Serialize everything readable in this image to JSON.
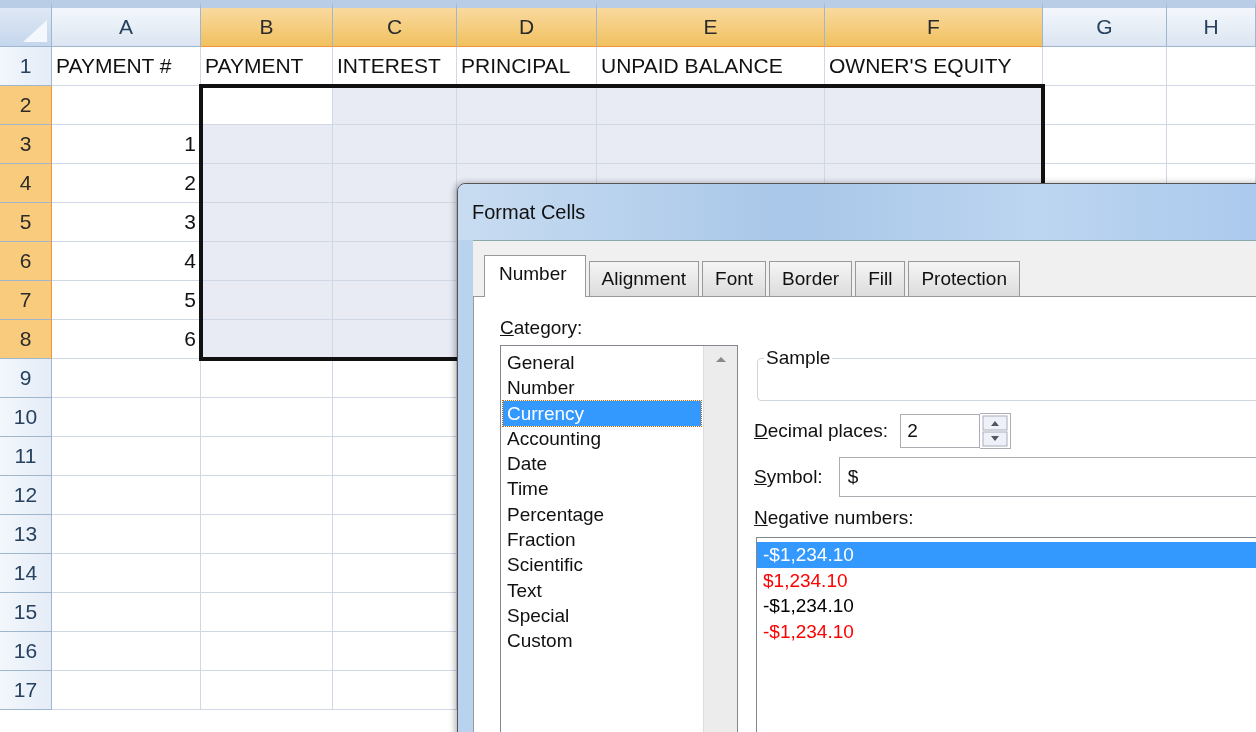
{
  "sheet": {
    "columns": [
      {
        "label": "A",
        "selected": false
      },
      {
        "label": "B",
        "selected": true
      },
      {
        "label": "C",
        "selected": true
      },
      {
        "label": "D",
        "selected": true
      },
      {
        "label": "E",
        "selected": true
      },
      {
        "label": "F",
        "selected": true
      },
      {
        "label": "G",
        "selected": false
      },
      {
        "label": "H",
        "selected": false
      }
    ],
    "rows": [
      {
        "header": "1",
        "selected": false,
        "cells": [
          "PAYMENT #",
          "PAYMENT",
          "INTEREST",
          "PRINCIPAL",
          "UNPAID BALANCE",
          "OWNER'S EQUITY"
        ]
      },
      {
        "header": "2",
        "selected": true,
        "cells": []
      },
      {
        "header": "3",
        "selected": true,
        "cells": [
          "1"
        ]
      },
      {
        "header": "4",
        "selected": true,
        "cells": [
          "2"
        ]
      },
      {
        "header": "5",
        "selected": true,
        "cells": [
          "3"
        ]
      },
      {
        "header": "6",
        "selected": true,
        "cells": [
          "4"
        ]
      },
      {
        "header": "7",
        "selected": true,
        "cells": [
          "5"
        ]
      },
      {
        "header": "8",
        "selected": true,
        "cells": [
          "6"
        ]
      },
      {
        "header": "9",
        "selected": false,
        "cells": []
      },
      {
        "header": "10",
        "selected": false,
        "cells": []
      },
      {
        "header": "11",
        "selected": false,
        "cells": []
      },
      {
        "header": "12",
        "selected": false,
        "cells": []
      },
      {
        "header": "13",
        "selected": false,
        "cells": []
      },
      {
        "header": "14",
        "selected": false,
        "cells": []
      },
      {
        "header": "15",
        "selected": false,
        "cells": []
      },
      {
        "header": "16",
        "selected": false,
        "cells": []
      },
      {
        "header": "17",
        "selected": false,
        "cells": []
      }
    ]
  },
  "dialog": {
    "title": "Format Cells",
    "tabs": [
      {
        "label": "Number",
        "selected": true
      },
      {
        "label": "Alignment",
        "selected": false
      },
      {
        "label": "Font",
        "selected": false
      },
      {
        "label": "Border",
        "selected": false
      },
      {
        "label": "Fill",
        "selected": false
      },
      {
        "label": "Protection",
        "selected": false
      }
    ],
    "category_label": "Category:",
    "categories": [
      {
        "label": "General",
        "selected": false
      },
      {
        "label": "Number",
        "selected": false
      },
      {
        "label": "Currency",
        "selected": true
      },
      {
        "label": "Accounting",
        "selected": false
      },
      {
        "label": "Date",
        "selected": false
      },
      {
        "label": "Time",
        "selected": false
      },
      {
        "label": "Percentage",
        "selected": false
      },
      {
        "label": "Fraction",
        "selected": false
      },
      {
        "label": "Scientific",
        "selected": false
      },
      {
        "label": "Text",
        "selected": false
      },
      {
        "label": "Special",
        "selected": false
      },
      {
        "label": "Custom",
        "selected": false
      }
    ],
    "sample_label": "Sample",
    "decimal_places": {
      "label": "Decimal places:",
      "value": "2"
    },
    "symbol": {
      "label": "Symbol:",
      "value": "$"
    },
    "negative_numbers": {
      "label": "Negative numbers:",
      "items": [
        {
          "text": "-$1,234.10",
          "selected": true
        },
        {
          "text": "$1,234.10",
          "color": "#ff0000",
          "selected": false
        },
        {
          "text": "-$1,234.10",
          "color": "#000000",
          "selected": false
        },
        {
          "text": "-$1,234.10",
          "color": "#ff0000",
          "selected": false
        }
      ]
    }
  }
}
